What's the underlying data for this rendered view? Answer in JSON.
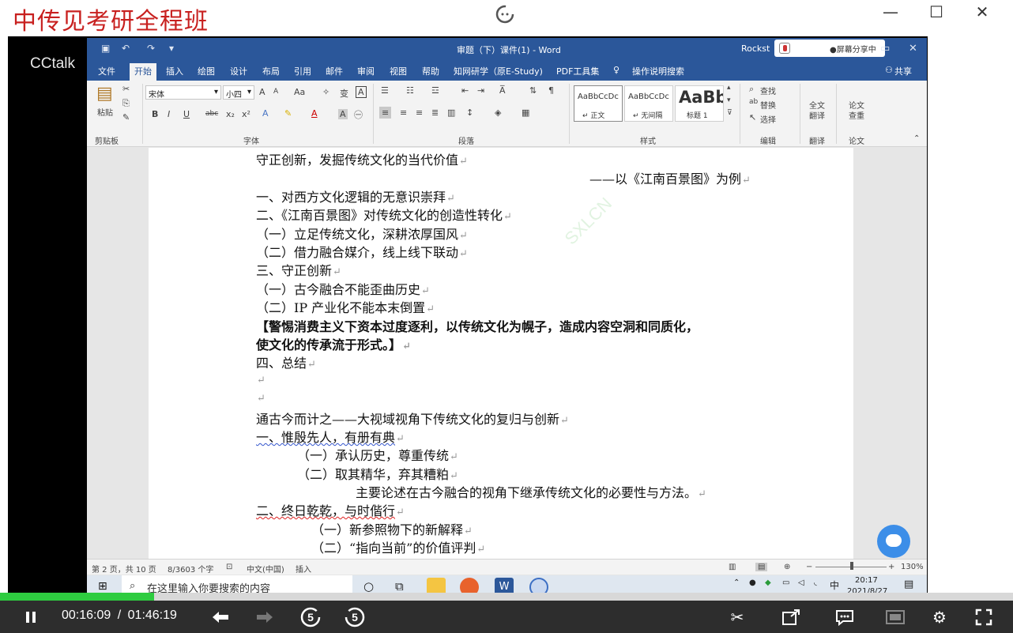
{
  "app": {
    "title": "中传见考研全程班",
    "window_controls": [
      "—",
      "☐",
      "✕"
    ]
  },
  "video": {
    "platform_logo": "CCtalk"
  },
  "word": {
    "window_title": "审题（下）课件(1) - Word",
    "account": "Rockst",
    "share_status": "●屏幕分享中",
    "title_controls": [
      "▭",
      "✕"
    ],
    "tabs": [
      "文件",
      "开始",
      "插入",
      "绘图",
      "设计",
      "布局",
      "引用",
      "邮件",
      "审阅",
      "视图",
      "帮助",
      "知网研学（原E-Study)",
      "PDF工具集",
      "操作说明搜索"
    ],
    "active_tab": "开始",
    "share_label": "共享",
    "ribbon": {
      "clipboard": {
        "paste": "粘贴",
        "label": "剪贴板"
      },
      "font": {
        "name": "宋体",
        "size": "小四",
        "label": "字体",
        "grow": "A",
        "shrink": "A",
        "case": "Aa",
        "bold": "B",
        "italic": "I",
        "underline": "U",
        "strike": "abc",
        "sub": "x₂",
        "sup": "x²"
      },
      "paragraph": {
        "label": "段落"
      },
      "styles": {
        "label": "样式",
        "items": [
          {
            "sample": "AaBbCcDc",
            "name": "↵ 正文"
          },
          {
            "sample": "AaBbCcDc",
            "name": "↵ 无间隔"
          },
          {
            "sample": "AaBb",
            "name": "标题 1"
          }
        ]
      },
      "editing": {
        "find": "查找",
        "replace": "替换",
        "select": "选择",
        "label": "编辑"
      },
      "translate": {
        "button": "全文翻译",
        "label": "翻译"
      },
      "paper": {
        "button": "论文查重",
        "label": "论文"
      }
    },
    "document": {
      "lines": [
        "守正创新，发掘传统文化的当代价值",
        "——以《江南百景图》为例",
        "一、对西方文化逻辑的无意识崇拜",
        "二、《江南百景图》对传统文化的创造性转化",
        "（一）立足传统文化，深耕浓厚国风",
        "（二）借力融合媒介，线上线下联动",
        "三、守正创新",
        "（一）古今融合不能歪曲历史",
        "（二）IP 产业化不能本末倒置",
        "【警惕消费主义下资本过度逐利，以传统文化为幌子，造成内容空洞和同质化，",
        "使文化的传承流于形式。】",
        "四、总结",
        "",
        "",
        "通古今而计之——大视域视角下传统文化的复归与创新",
        "一、惟殷先人，有册有典",
        "（一）承认历史，尊重传统",
        "（二）取其精华，弃其糟粕",
        "主要论述在古今融合的视角下继承传统文化的必要性与方法。",
        "二、终日乾乾，与时偕行",
        "（一）新参照物下的新解释",
        "（二）“指向当前”的价值评判"
      ],
      "watermark": "SXLCN"
    },
    "status_bar": {
      "page": "第 2 页，共 10 页",
      "words": "8/3603 个字",
      "language": "中文(中国)",
      "mode": "插入",
      "zoom": "130%"
    }
  },
  "taskbar": {
    "search_placeholder": "在这里输入你要搜索的内容",
    "time": "20:17",
    "date": "2021/8/27",
    "ime": "中"
  },
  "player": {
    "current_time": "00:16:09",
    "separator": "/",
    "total_time": "01:46:19",
    "progress_fraction": 0.152,
    "skip_back": "5",
    "skip_forward": "5"
  },
  "colors": {
    "title_red": "#c8201f",
    "word_blue": "#2b579a",
    "progress_green": "#2ecc40"
  }
}
